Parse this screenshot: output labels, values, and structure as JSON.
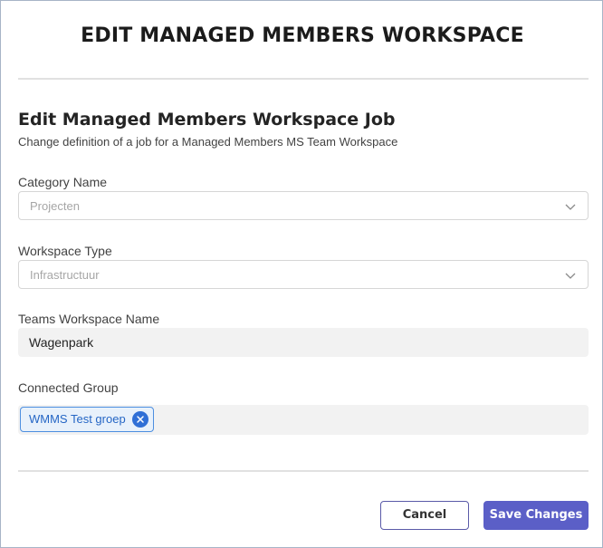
{
  "dialog": {
    "title": "EDIT MANAGED MEMBERS WORKSPACE",
    "section_title": "Edit Managed Members Workspace Job",
    "section_description": "Change definition of a job for a Managed Members MS Team Workspace"
  },
  "fields": {
    "category": {
      "label": "Category Name",
      "value": "Projecten"
    },
    "workspace_type": {
      "label": "Workspace Type",
      "value": "Infrastructuur"
    },
    "teams_workspace_name": {
      "label": "Teams Workspace Name",
      "value": "Wagenpark"
    },
    "connected_group": {
      "label": "Connected Group",
      "selected": [
        "WMMS Test groep"
      ]
    }
  },
  "buttons": {
    "cancel": "Cancel",
    "save": "Save Changes"
  },
  "icons": {
    "dropdown": "chevron-down-icon",
    "remove": "close-circle-icon"
  },
  "colors": {
    "primary": "#5b5fc7",
    "chip_border": "#4d8fe0",
    "chip_background": "#e8f1fb",
    "chip_text": "#2566c5"
  }
}
